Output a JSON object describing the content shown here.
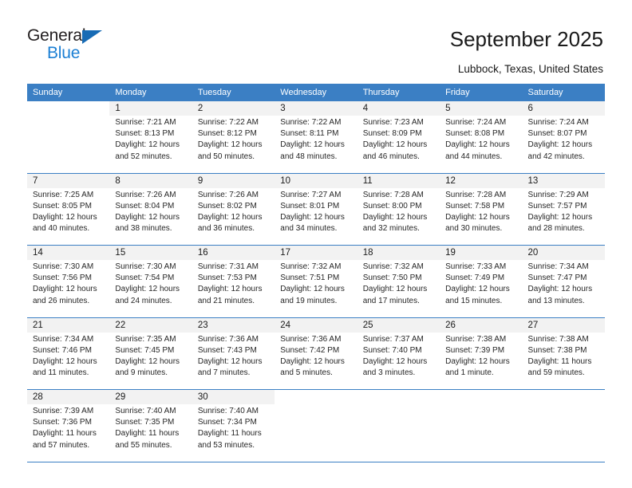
{
  "logo": {
    "word_one": "General",
    "word_two": "Blue",
    "triangle_color": "#176BB5",
    "blue_color": "#1B7FD4"
  },
  "header": {
    "title": "September 2025",
    "subtitle": "Lubbock, Texas, United States"
  },
  "calendar": {
    "header_bg": "#3B7FC4",
    "daynum_bg": "#F2F2F2",
    "weekday_headers": [
      "Sunday",
      "Monday",
      "Tuesday",
      "Wednesday",
      "Thursday",
      "Friday",
      "Saturday"
    ],
    "weeks": [
      [
        {
          "day": "",
          "sunrise": "",
          "sunset": "",
          "daylight_1": "",
          "daylight_2": ""
        },
        {
          "day": "1",
          "sunrise": "Sunrise: 7:21 AM",
          "sunset": "Sunset: 8:13 PM",
          "daylight_1": "Daylight: 12 hours",
          "daylight_2": "and 52 minutes."
        },
        {
          "day": "2",
          "sunrise": "Sunrise: 7:22 AM",
          "sunset": "Sunset: 8:12 PM",
          "daylight_1": "Daylight: 12 hours",
          "daylight_2": "and 50 minutes."
        },
        {
          "day": "3",
          "sunrise": "Sunrise: 7:22 AM",
          "sunset": "Sunset: 8:11 PM",
          "daylight_1": "Daylight: 12 hours",
          "daylight_2": "and 48 minutes."
        },
        {
          "day": "4",
          "sunrise": "Sunrise: 7:23 AM",
          "sunset": "Sunset: 8:09 PM",
          "daylight_1": "Daylight: 12 hours",
          "daylight_2": "and 46 minutes."
        },
        {
          "day": "5",
          "sunrise": "Sunrise: 7:24 AM",
          "sunset": "Sunset: 8:08 PM",
          "daylight_1": "Daylight: 12 hours",
          "daylight_2": "and 44 minutes."
        },
        {
          "day": "6",
          "sunrise": "Sunrise: 7:24 AM",
          "sunset": "Sunset: 8:07 PM",
          "daylight_1": "Daylight: 12 hours",
          "daylight_2": "and 42 minutes."
        }
      ],
      [
        {
          "day": "7",
          "sunrise": "Sunrise: 7:25 AM",
          "sunset": "Sunset: 8:05 PM",
          "daylight_1": "Daylight: 12 hours",
          "daylight_2": "and 40 minutes."
        },
        {
          "day": "8",
          "sunrise": "Sunrise: 7:26 AM",
          "sunset": "Sunset: 8:04 PM",
          "daylight_1": "Daylight: 12 hours",
          "daylight_2": "and 38 minutes."
        },
        {
          "day": "9",
          "sunrise": "Sunrise: 7:26 AM",
          "sunset": "Sunset: 8:02 PM",
          "daylight_1": "Daylight: 12 hours",
          "daylight_2": "and 36 minutes."
        },
        {
          "day": "10",
          "sunrise": "Sunrise: 7:27 AM",
          "sunset": "Sunset: 8:01 PM",
          "daylight_1": "Daylight: 12 hours",
          "daylight_2": "and 34 minutes."
        },
        {
          "day": "11",
          "sunrise": "Sunrise: 7:28 AM",
          "sunset": "Sunset: 8:00 PM",
          "daylight_1": "Daylight: 12 hours",
          "daylight_2": "and 32 minutes."
        },
        {
          "day": "12",
          "sunrise": "Sunrise: 7:28 AM",
          "sunset": "Sunset: 7:58 PM",
          "daylight_1": "Daylight: 12 hours",
          "daylight_2": "and 30 minutes."
        },
        {
          "day": "13",
          "sunrise": "Sunrise: 7:29 AM",
          "sunset": "Sunset: 7:57 PM",
          "daylight_1": "Daylight: 12 hours",
          "daylight_2": "and 28 minutes."
        }
      ],
      [
        {
          "day": "14",
          "sunrise": "Sunrise: 7:30 AM",
          "sunset": "Sunset: 7:56 PM",
          "daylight_1": "Daylight: 12 hours",
          "daylight_2": "and 26 minutes."
        },
        {
          "day": "15",
          "sunrise": "Sunrise: 7:30 AM",
          "sunset": "Sunset: 7:54 PM",
          "daylight_1": "Daylight: 12 hours",
          "daylight_2": "and 24 minutes."
        },
        {
          "day": "16",
          "sunrise": "Sunrise: 7:31 AM",
          "sunset": "Sunset: 7:53 PM",
          "daylight_1": "Daylight: 12 hours",
          "daylight_2": "and 21 minutes."
        },
        {
          "day": "17",
          "sunrise": "Sunrise: 7:32 AM",
          "sunset": "Sunset: 7:51 PM",
          "daylight_1": "Daylight: 12 hours",
          "daylight_2": "and 19 minutes."
        },
        {
          "day": "18",
          "sunrise": "Sunrise: 7:32 AM",
          "sunset": "Sunset: 7:50 PM",
          "daylight_1": "Daylight: 12 hours",
          "daylight_2": "and 17 minutes."
        },
        {
          "day": "19",
          "sunrise": "Sunrise: 7:33 AM",
          "sunset": "Sunset: 7:49 PM",
          "daylight_1": "Daylight: 12 hours",
          "daylight_2": "and 15 minutes."
        },
        {
          "day": "20",
          "sunrise": "Sunrise: 7:34 AM",
          "sunset": "Sunset: 7:47 PM",
          "daylight_1": "Daylight: 12 hours",
          "daylight_2": "and 13 minutes."
        }
      ],
      [
        {
          "day": "21",
          "sunrise": "Sunrise: 7:34 AM",
          "sunset": "Sunset: 7:46 PM",
          "daylight_1": "Daylight: 12 hours",
          "daylight_2": "and 11 minutes."
        },
        {
          "day": "22",
          "sunrise": "Sunrise: 7:35 AM",
          "sunset": "Sunset: 7:45 PM",
          "daylight_1": "Daylight: 12 hours",
          "daylight_2": "and 9 minutes."
        },
        {
          "day": "23",
          "sunrise": "Sunrise: 7:36 AM",
          "sunset": "Sunset: 7:43 PM",
          "daylight_1": "Daylight: 12 hours",
          "daylight_2": "and 7 minutes."
        },
        {
          "day": "24",
          "sunrise": "Sunrise: 7:36 AM",
          "sunset": "Sunset: 7:42 PM",
          "daylight_1": "Daylight: 12 hours",
          "daylight_2": "and 5 minutes."
        },
        {
          "day": "25",
          "sunrise": "Sunrise: 7:37 AM",
          "sunset": "Sunset: 7:40 PM",
          "daylight_1": "Daylight: 12 hours",
          "daylight_2": "and 3 minutes."
        },
        {
          "day": "26",
          "sunrise": "Sunrise: 7:38 AM",
          "sunset": "Sunset: 7:39 PM",
          "daylight_1": "Daylight: 12 hours",
          "daylight_2": "and 1 minute."
        },
        {
          "day": "27",
          "sunrise": "Sunrise: 7:38 AM",
          "sunset": "Sunset: 7:38 PM",
          "daylight_1": "Daylight: 11 hours",
          "daylight_2": "and 59 minutes."
        }
      ],
      [
        {
          "day": "28",
          "sunrise": "Sunrise: 7:39 AM",
          "sunset": "Sunset: 7:36 PM",
          "daylight_1": "Daylight: 11 hours",
          "daylight_2": "and 57 minutes."
        },
        {
          "day": "29",
          "sunrise": "Sunrise: 7:40 AM",
          "sunset": "Sunset: 7:35 PM",
          "daylight_1": "Daylight: 11 hours",
          "daylight_2": "and 55 minutes."
        },
        {
          "day": "30",
          "sunrise": "Sunrise: 7:40 AM",
          "sunset": "Sunset: 7:34 PM",
          "daylight_1": "Daylight: 11 hours",
          "daylight_2": "and 53 minutes."
        },
        {
          "day": "",
          "sunrise": "",
          "sunset": "",
          "daylight_1": "",
          "daylight_2": ""
        },
        {
          "day": "",
          "sunrise": "",
          "sunset": "",
          "daylight_1": "",
          "daylight_2": ""
        },
        {
          "day": "",
          "sunrise": "",
          "sunset": "",
          "daylight_1": "",
          "daylight_2": ""
        },
        {
          "day": "",
          "sunrise": "",
          "sunset": "",
          "daylight_1": "",
          "daylight_2": ""
        }
      ]
    ]
  }
}
